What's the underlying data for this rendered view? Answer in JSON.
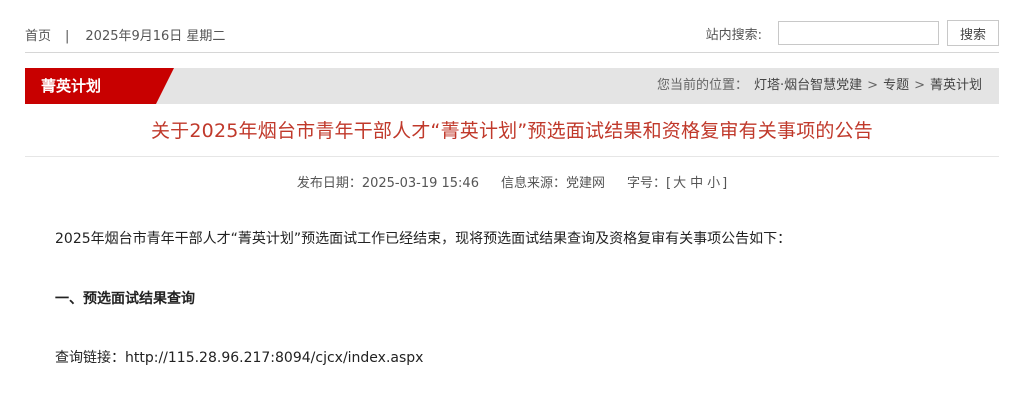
{
  "topbar": {
    "home_link": "首页",
    "separator": "|",
    "date": "2025年9月16日 星期二",
    "search_label": "站内搜索:",
    "search_value": "",
    "search_button": "搜索"
  },
  "section": {
    "tab_label": "菁英计划",
    "breadcrumb_prefix": "您当前的位置：",
    "breadcrumb": [
      "灯塔·烟台智慧党建",
      "专题",
      "菁英计划"
    ],
    "breadcrumb_arrow": ">"
  },
  "article": {
    "title": "关于2025年烟台市青年干部人才“菁英计划”预选面试结果和资格复审有关事项的公告",
    "meta": {
      "publish_date": "发布日期：2025-03-19 15:46",
      "source": "信息来源：党建网",
      "fontsize_label": "字号：[",
      "fontsize_options": [
        "大",
        "中",
        "小"
      ],
      "fontsize_close": "]"
    },
    "paragraphs": {
      "intro": "2025年烟台市青年干部人才“菁英计划”预选面试工作已经结束，现将预选面试结果查询及资格复审有关事项公告如下：",
      "heading1": "一、预选面试结果查询",
      "link_line": "查询链接：http://115.28.96.217:8094/cjcx/index.aspx"
    }
  },
  "colors": {
    "accent_red": "#c80000",
    "title_red": "#c0392b",
    "bar_gray": "#e4e4e4"
  }
}
